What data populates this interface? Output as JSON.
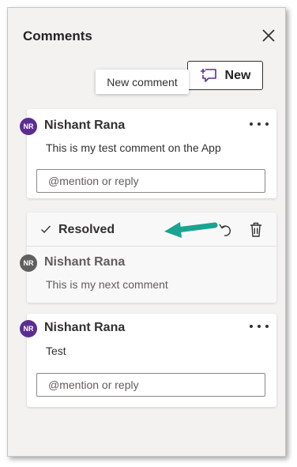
{
  "panel": {
    "title": "Comments",
    "tooltip": "New comment",
    "new_button_label": "New"
  },
  "comments": [
    {
      "initials": "NR",
      "author": "Nishant Rana",
      "text": "This is my test comment on the App",
      "reply_placeholder": "@mention or reply"
    },
    {
      "status": "Resolved",
      "initials": "NR",
      "author": "Nishant Rana",
      "text": "This is my next comment"
    },
    {
      "initials": "NR",
      "author": "Nishant Rana",
      "text": "Test",
      "reply_placeholder": "@mention or reply"
    }
  ],
  "colors": {
    "avatar_active": "#5c2d91",
    "avatar_resolved": "#5f5f5f",
    "annotation_arrow": "#1aa391"
  },
  "icons": [
    "close-icon",
    "new-comment-icon",
    "more-icon",
    "checkmark-icon",
    "reopen-icon",
    "delete-icon",
    "arrow-annotation"
  ]
}
